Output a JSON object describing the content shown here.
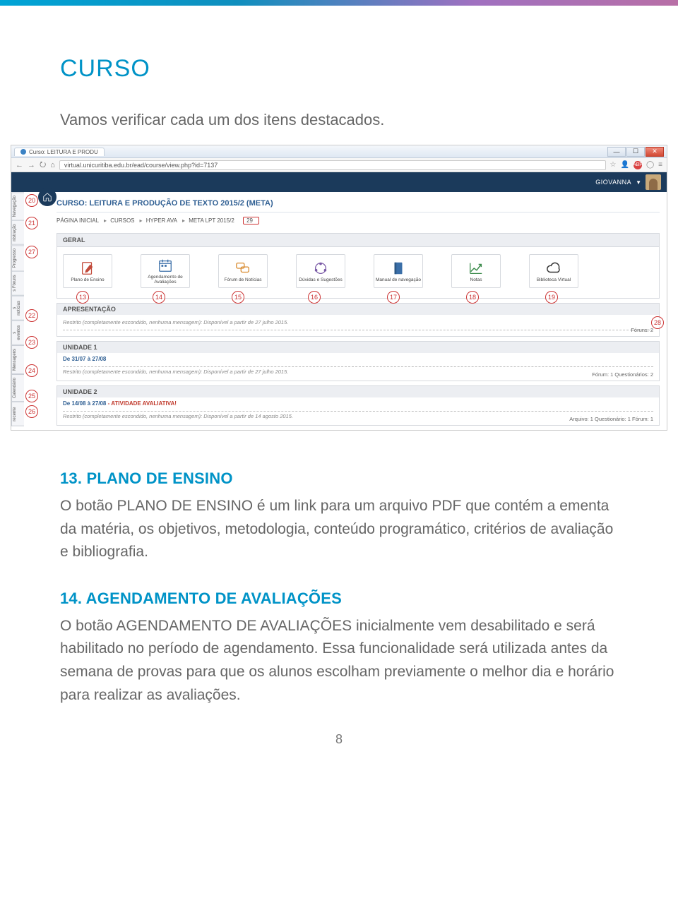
{
  "doc": {
    "heading": "CURSO",
    "lead": "Vamos verificar cada um dos itens destacados.",
    "items": [
      {
        "heading": "13. PLANO DE ENSINO",
        "text": "O botão PLANO DE ENSINO é um link para um arquivo PDF que contém a ementa da matéria, os objetivos, metodologia, conteúdo programático, critérios de avaliação e bibliografia."
      },
      {
        "heading": "14. AGENDAMENTO DE AVALIAÇÕES",
        "text": "O botão AGENDAMENTO DE AVALIAÇÕES inicialmente vem desabilitado e será habilitado no período de agendamento. Essa funcionalidade será utilizada antes da semana de provas para que os alunos escolham previamente o melhor dia e horário para realizar as avaliações."
      }
    ],
    "pageNumber": "8"
  },
  "shot": {
    "tabTitle": "Curso: LEITURA E PRODU",
    "url": "virtual.unicuritiba.edu.br/ead/course/view.php?id=7137",
    "userName": "GIOVANNA",
    "courseTitle": "CURSO: LEITURA E PRODUÇÃO DE TEXTO 2015/2 (META)",
    "crumbs": [
      "PÁGINA INICIAL",
      "CURSOS",
      "HYPER AVA",
      "META LPT 2015/2"
    ],
    "vtabs": [
      "Navegação",
      "nistração",
      "Progresso",
      "s Fóruns",
      "s notícias",
      "s eventos",
      "Mensagens",
      "Calendário",
      "recente"
    ],
    "geral": {
      "title": "GERAL",
      "cards": [
        {
          "label": "Plano de Ensino"
        },
        {
          "label": "Agendamento de Avaliações"
        },
        {
          "label": "Fórum de Notícias"
        },
        {
          "label": "Dúvidas e Sugestões"
        },
        {
          "label": "Manual de navegação"
        },
        {
          "label": "Notas"
        },
        {
          "label": "Biblioteca Virtual"
        }
      ]
    },
    "sections": [
      {
        "title": "APRESENTAÇÃO",
        "restrict": "Restrito (completamente escondido, nenhuma mensagem): Disponível a partir de 27 julho 2015.",
        "meta": "Fóruns: 2"
      },
      {
        "title": "UNIDADE 1",
        "dates": "De 31/07 à 27/08",
        "restrict": "Restrito (completamente escondido, nenhuma mensagem): Disponível a partir de 27 julho 2015.",
        "meta": "Fórum: 1   Questionários: 2"
      },
      {
        "title": "UNIDADE 2",
        "dates": "De 14/08 à 27/08",
        "flag": "ATIVIDADE AVALIATIVA!",
        "restrict": "Restrito (completamente escondido, nenhuma mensagem): Disponível a partir de 14 agosto 2015.",
        "meta": "Arquivo: 1   Questionário: 1   Fórum: 1"
      }
    ],
    "callouts": {
      "c13": "13",
      "c14": "14",
      "c15": "15",
      "c16": "16",
      "c17": "17",
      "c18": "18",
      "c19": "19",
      "c20": "20",
      "c21": "21",
      "c22": "22",
      "c23": "23",
      "c24": "24",
      "c25": "25",
      "c26": "26",
      "c27": "27",
      "c28": "28",
      "c29": "29"
    }
  }
}
